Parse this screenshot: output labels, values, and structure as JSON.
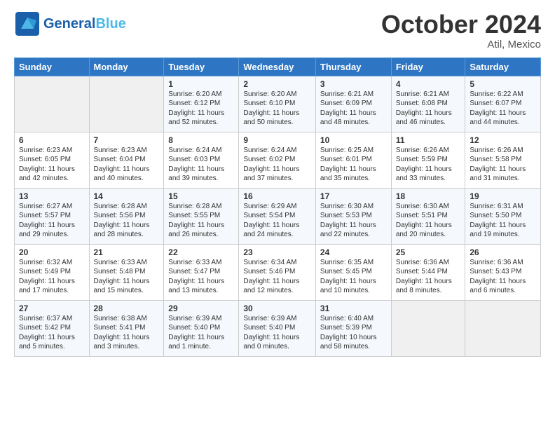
{
  "header": {
    "logo_line1": "General",
    "logo_line2": "Blue",
    "month": "October 2024",
    "location": "Atil, Mexico"
  },
  "days_of_week": [
    "Sunday",
    "Monday",
    "Tuesday",
    "Wednesday",
    "Thursday",
    "Friday",
    "Saturday"
  ],
  "weeks": [
    [
      {
        "day": "",
        "info": ""
      },
      {
        "day": "",
        "info": ""
      },
      {
        "day": "1",
        "info": "Sunrise: 6:20 AM\nSunset: 6:12 PM\nDaylight: 11 hours\nand 52 minutes."
      },
      {
        "day": "2",
        "info": "Sunrise: 6:20 AM\nSunset: 6:10 PM\nDaylight: 11 hours\nand 50 minutes."
      },
      {
        "day": "3",
        "info": "Sunrise: 6:21 AM\nSunset: 6:09 PM\nDaylight: 11 hours\nand 48 minutes."
      },
      {
        "day": "4",
        "info": "Sunrise: 6:21 AM\nSunset: 6:08 PM\nDaylight: 11 hours\nand 46 minutes."
      },
      {
        "day": "5",
        "info": "Sunrise: 6:22 AM\nSunset: 6:07 PM\nDaylight: 11 hours\nand 44 minutes."
      }
    ],
    [
      {
        "day": "6",
        "info": "Sunrise: 6:23 AM\nSunset: 6:05 PM\nDaylight: 11 hours\nand 42 minutes."
      },
      {
        "day": "7",
        "info": "Sunrise: 6:23 AM\nSunset: 6:04 PM\nDaylight: 11 hours\nand 40 minutes."
      },
      {
        "day": "8",
        "info": "Sunrise: 6:24 AM\nSunset: 6:03 PM\nDaylight: 11 hours\nand 39 minutes."
      },
      {
        "day": "9",
        "info": "Sunrise: 6:24 AM\nSunset: 6:02 PM\nDaylight: 11 hours\nand 37 minutes."
      },
      {
        "day": "10",
        "info": "Sunrise: 6:25 AM\nSunset: 6:01 PM\nDaylight: 11 hours\nand 35 minutes."
      },
      {
        "day": "11",
        "info": "Sunrise: 6:26 AM\nSunset: 5:59 PM\nDaylight: 11 hours\nand 33 minutes."
      },
      {
        "day": "12",
        "info": "Sunrise: 6:26 AM\nSunset: 5:58 PM\nDaylight: 11 hours\nand 31 minutes."
      }
    ],
    [
      {
        "day": "13",
        "info": "Sunrise: 6:27 AM\nSunset: 5:57 PM\nDaylight: 11 hours\nand 29 minutes."
      },
      {
        "day": "14",
        "info": "Sunrise: 6:28 AM\nSunset: 5:56 PM\nDaylight: 11 hours\nand 28 minutes."
      },
      {
        "day": "15",
        "info": "Sunrise: 6:28 AM\nSunset: 5:55 PM\nDaylight: 11 hours\nand 26 minutes."
      },
      {
        "day": "16",
        "info": "Sunrise: 6:29 AM\nSunset: 5:54 PM\nDaylight: 11 hours\nand 24 minutes."
      },
      {
        "day": "17",
        "info": "Sunrise: 6:30 AM\nSunset: 5:53 PM\nDaylight: 11 hours\nand 22 minutes."
      },
      {
        "day": "18",
        "info": "Sunrise: 6:30 AM\nSunset: 5:51 PM\nDaylight: 11 hours\nand 20 minutes."
      },
      {
        "day": "19",
        "info": "Sunrise: 6:31 AM\nSunset: 5:50 PM\nDaylight: 11 hours\nand 19 minutes."
      }
    ],
    [
      {
        "day": "20",
        "info": "Sunrise: 6:32 AM\nSunset: 5:49 PM\nDaylight: 11 hours\nand 17 minutes."
      },
      {
        "day": "21",
        "info": "Sunrise: 6:33 AM\nSunset: 5:48 PM\nDaylight: 11 hours\nand 15 minutes."
      },
      {
        "day": "22",
        "info": "Sunrise: 6:33 AM\nSunset: 5:47 PM\nDaylight: 11 hours\nand 13 minutes."
      },
      {
        "day": "23",
        "info": "Sunrise: 6:34 AM\nSunset: 5:46 PM\nDaylight: 11 hours\nand 12 minutes."
      },
      {
        "day": "24",
        "info": "Sunrise: 6:35 AM\nSunset: 5:45 PM\nDaylight: 11 hours\nand 10 minutes."
      },
      {
        "day": "25",
        "info": "Sunrise: 6:36 AM\nSunset: 5:44 PM\nDaylight: 11 hours\nand 8 minutes."
      },
      {
        "day": "26",
        "info": "Sunrise: 6:36 AM\nSunset: 5:43 PM\nDaylight: 11 hours\nand 6 minutes."
      }
    ],
    [
      {
        "day": "27",
        "info": "Sunrise: 6:37 AM\nSunset: 5:42 PM\nDaylight: 11 hours\nand 5 minutes."
      },
      {
        "day": "28",
        "info": "Sunrise: 6:38 AM\nSunset: 5:41 PM\nDaylight: 11 hours\nand 3 minutes."
      },
      {
        "day": "29",
        "info": "Sunrise: 6:39 AM\nSunset: 5:40 PM\nDaylight: 11 hours\nand 1 minute."
      },
      {
        "day": "30",
        "info": "Sunrise: 6:39 AM\nSunset: 5:40 PM\nDaylight: 11 hours\nand 0 minutes."
      },
      {
        "day": "31",
        "info": "Sunrise: 6:40 AM\nSunset: 5:39 PM\nDaylight: 10 hours\nand 58 minutes."
      },
      {
        "day": "",
        "info": ""
      },
      {
        "day": "",
        "info": ""
      }
    ]
  ]
}
